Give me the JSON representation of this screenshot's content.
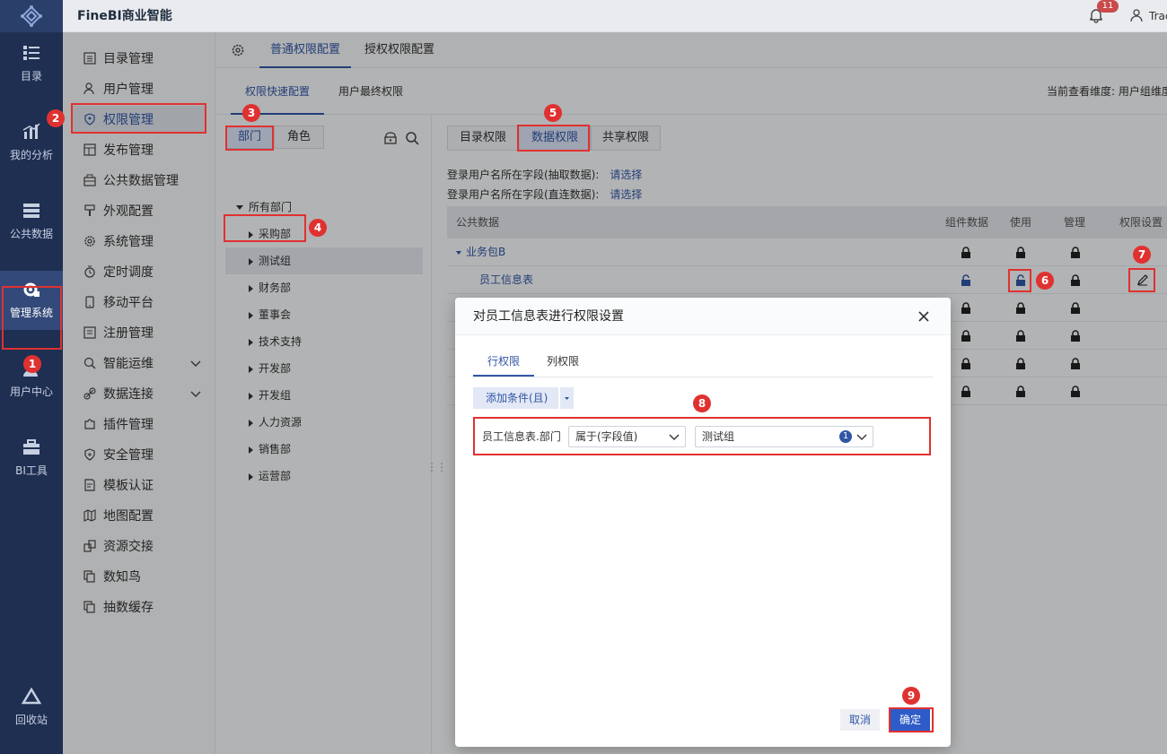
{
  "app": {
    "title": "FineBI商业智能",
    "notif_count": "11",
    "user_name": "Trac"
  },
  "leftnav": [
    {
      "label": "目录",
      "icon": "catalog-icon"
    },
    {
      "label": "我的分析",
      "icon": "analysis-icon"
    },
    {
      "label": "公共数据",
      "icon": "public-data-icon"
    },
    {
      "label": "管理系统",
      "icon": "system-gear-icon"
    },
    {
      "label": "用户中心",
      "icon": "user-center-icon"
    },
    {
      "label": "BI工具",
      "icon": "toolbox-icon"
    },
    {
      "label": "回收站",
      "icon": "recycle-icon"
    }
  ],
  "menu": [
    {
      "label": "目录管理",
      "icon": "list-icon"
    },
    {
      "label": "用户管理",
      "icon": "user-icon"
    },
    {
      "label": "权限管理",
      "icon": "shield-icon"
    },
    {
      "label": "发布管理",
      "icon": "publish-icon"
    },
    {
      "label": "公共数据管理",
      "icon": "database-icon"
    },
    {
      "label": "外观配置",
      "icon": "brush-icon"
    },
    {
      "label": "系统管理",
      "icon": "gear-icon"
    },
    {
      "label": "定时调度",
      "icon": "timer-icon"
    },
    {
      "label": "移动平台",
      "icon": "mobile-icon"
    },
    {
      "label": "注册管理",
      "icon": "register-icon"
    },
    {
      "label": "智能运维",
      "icon": "ops-icon"
    },
    {
      "label": "数据连接",
      "icon": "link-icon"
    },
    {
      "label": "插件管理",
      "icon": "plugin-icon"
    },
    {
      "label": "安全管理",
      "icon": "security-icon"
    },
    {
      "label": "模板认证",
      "icon": "cert-icon"
    },
    {
      "label": "地图配置",
      "icon": "map-icon"
    },
    {
      "label": "资源交接",
      "icon": "transfer-icon"
    },
    {
      "label": "数知鸟",
      "icon": "copy-icon"
    },
    {
      "label": "抽数缓存",
      "icon": "copy-icon"
    }
  ],
  "tabs": {
    "top": [
      "普通权限配置",
      "授权权限配置"
    ],
    "sub": [
      "权限快速配置",
      "用户最终权限"
    ],
    "view_dim": "当前查看维度: 用户组维度"
  },
  "tree": {
    "seg": [
      "部门",
      "角色"
    ],
    "root": "所有部门",
    "nodes": [
      "采购部",
      "测试组",
      "财务部",
      "董事会",
      "技术支持",
      "开发部",
      "开发组",
      "人力资源",
      "销售部",
      "运营部"
    ]
  },
  "perm": {
    "seg": [
      "目录权限",
      "数据权限",
      "共享权限"
    ],
    "field1_label": "登录用户名所在字段(抽取数据):",
    "field2_label": "登录用户名所在字段(直连数据):",
    "choose": "请选择",
    "headers": [
      "公共数据",
      "组件数据",
      "使用",
      "管理",
      "权限设置"
    ],
    "group": "业务包B",
    "table": "员工信息表"
  },
  "dialog": {
    "title": "对员工信息表进行权限设置",
    "tabs": [
      "行权限",
      "列权限"
    ],
    "add_label": "添加条件(且)",
    "cond_field": "员工信息表.部门",
    "cond_op": "属于(字段值)",
    "cond_value": "测试组",
    "cond_value_count": "1",
    "cancel": "取消",
    "ok": "确定"
  },
  "markers": [
    "1",
    "2",
    "3",
    "4",
    "5",
    "6",
    "7",
    "8",
    "9"
  ]
}
